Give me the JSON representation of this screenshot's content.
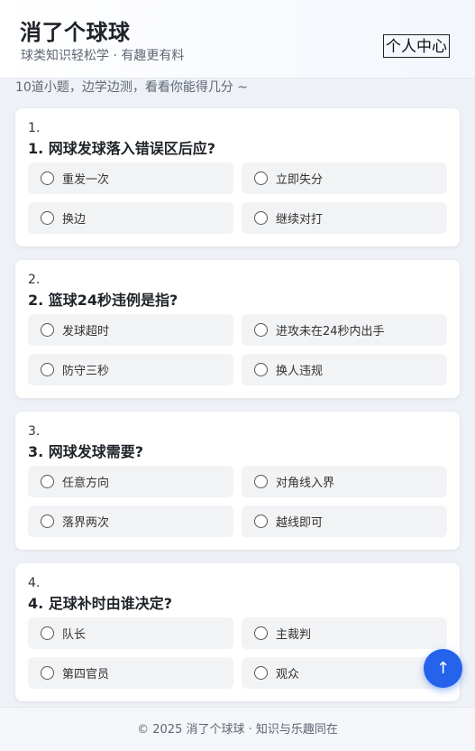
{
  "header": {
    "title": "消了个球球",
    "subtitle": "球类知识轻松学 · 有趣更有料",
    "user_button": "个人中心"
  },
  "intro": "10道小题，边学边测，看看你能得几分 ~",
  "questions": [
    {
      "number": "1.",
      "text": "1. 网球发球落入错误区后应?",
      "options": [
        "重发一次",
        "立即失分",
        "换边",
        "继续对打"
      ]
    },
    {
      "number": "2.",
      "text": "2. 篮球24秒违例是指?",
      "options": [
        "发球超时",
        "进攻未在24秒内出手",
        "防守三秒",
        "换人违规"
      ]
    },
    {
      "number": "3.",
      "text": "3. 网球发球需要?",
      "options": [
        "任意方向",
        "对角线入界",
        "落界两次",
        "越线即可"
      ]
    },
    {
      "number": "4.",
      "text": "4. 足球补时由谁决定?",
      "options": [
        "队长",
        "主裁判",
        "第四官员",
        "观众"
      ]
    }
  ],
  "footer": {
    "text": "© 2025 消了个球球 · 知识与乐趣同在"
  },
  "back_to_top": {
    "label": "↑"
  },
  "colors": {
    "accent": "#2563eb",
    "option_bg": "#f2f3f5",
    "page_bg": "#eef1f6"
  }
}
